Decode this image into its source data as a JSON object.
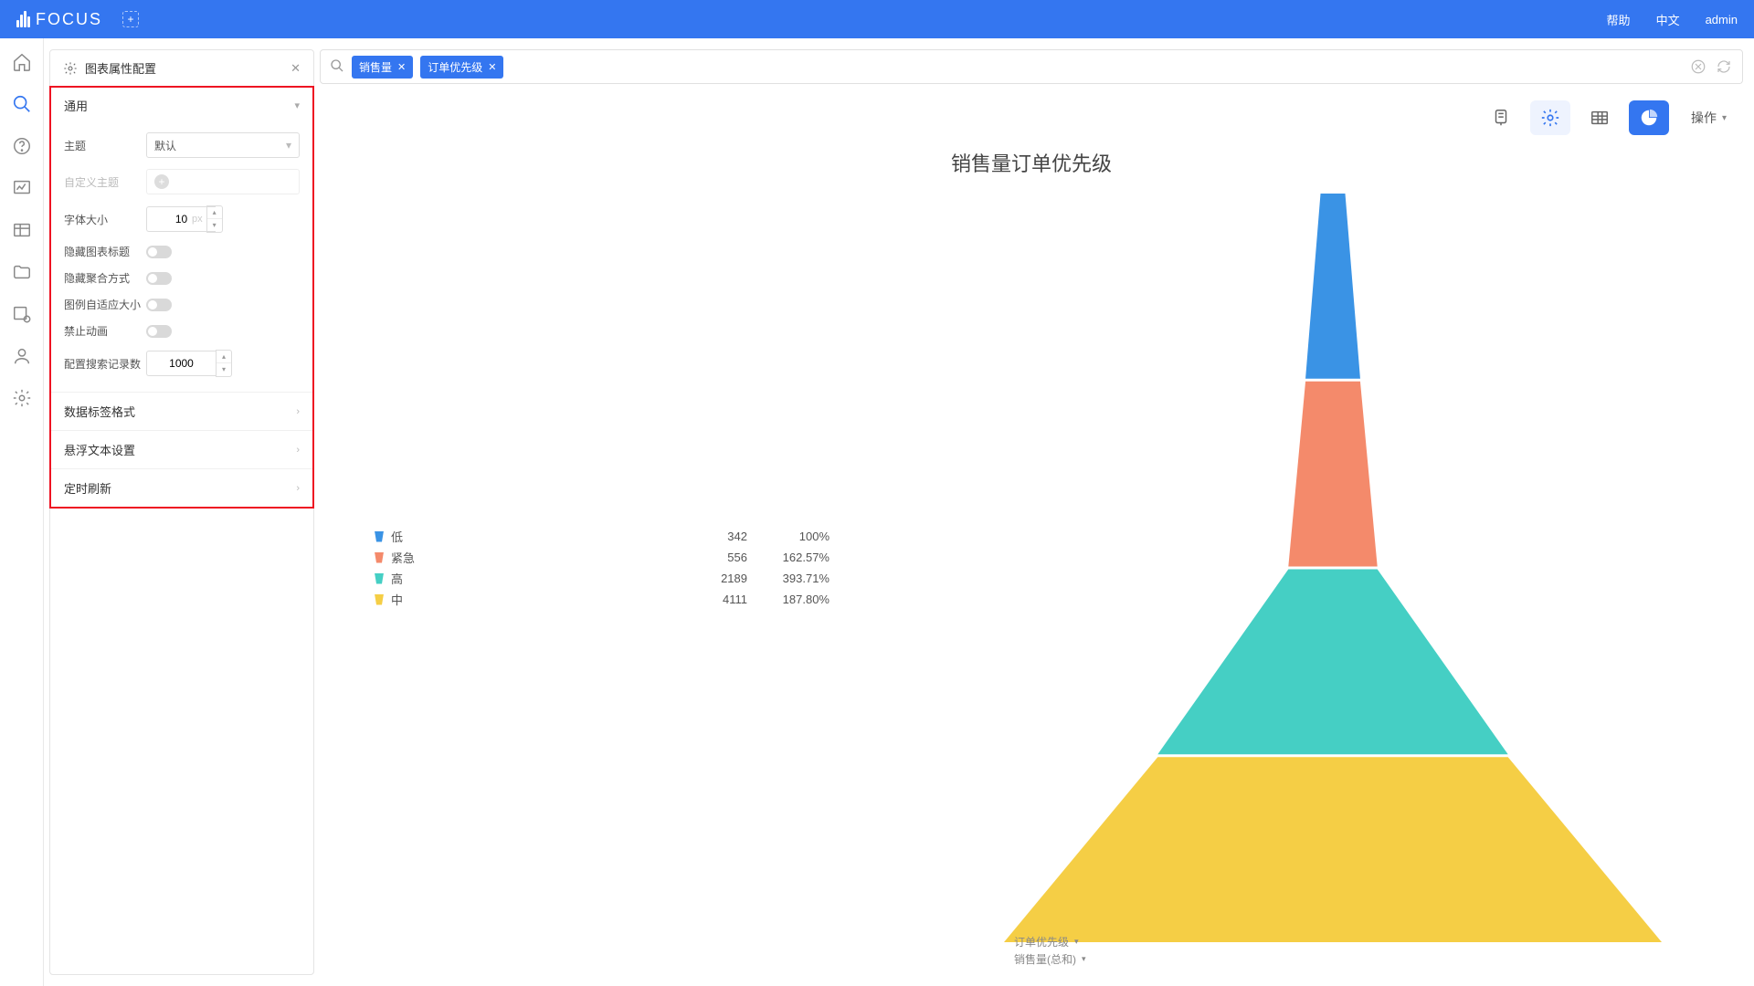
{
  "app": {
    "name": "FOCUS"
  },
  "topnav": {
    "help": "帮助",
    "lang": "中文",
    "user": "admin"
  },
  "config": {
    "title": "图表属性配置",
    "sections": {
      "general": {
        "label": "通用"
      },
      "data_label_format": "数据标签格式",
      "tooltip_settings": "悬浮文本设置",
      "auto_refresh": "定时刷新"
    },
    "fields": {
      "theme_label": "主题",
      "theme_value": "默认",
      "custom_theme_label": "自定义主题",
      "font_size_label": "字体大小",
      "font_size_value": "10",
      "font_size_unit": "px",
      "hide_title_label": "隐藏图表标题",
      "hide_agg_label": "隐藏聚合方式",
      "legend_auto_label": "图例自适应大小",
      "disable_anim_label": "禁止动画",
      "record_limit_label": "配置搜索记录数",
      "record_limit_value": "1000"
    }
  },
  "search": {
    "chips": [
      {
        "label": "销售量"
      },
      {
        "label": "订单优先级"
      }
    ]
  },
  "toolbar": {
    "action_label": "操作"
  },
  "chart_data": {
    "type": "funnel",
    "title": "销售量订单优先级",
    "dimension": "订单优先级",
    "measure": "销售量(总和)",
    "series": [
      {
        "name": "低",
        "value": 342,
        "pct": "100%",
        "color": "#3a93e5"
      },
      {
        "name": "紧急",
        "value": 556,
        "pct": "162.57%",
        "color": "#f48a6b"
      },
      {
        "name": "高",
        "value": 2189,
        "pct": "393.71%",
        "color": "#45cfc4"
      },
      {
        "name": "中",
        "value": 4111,
        "pct": "187.80%",
        "color": "#f5ce45"
      }
    ]
  }
}
